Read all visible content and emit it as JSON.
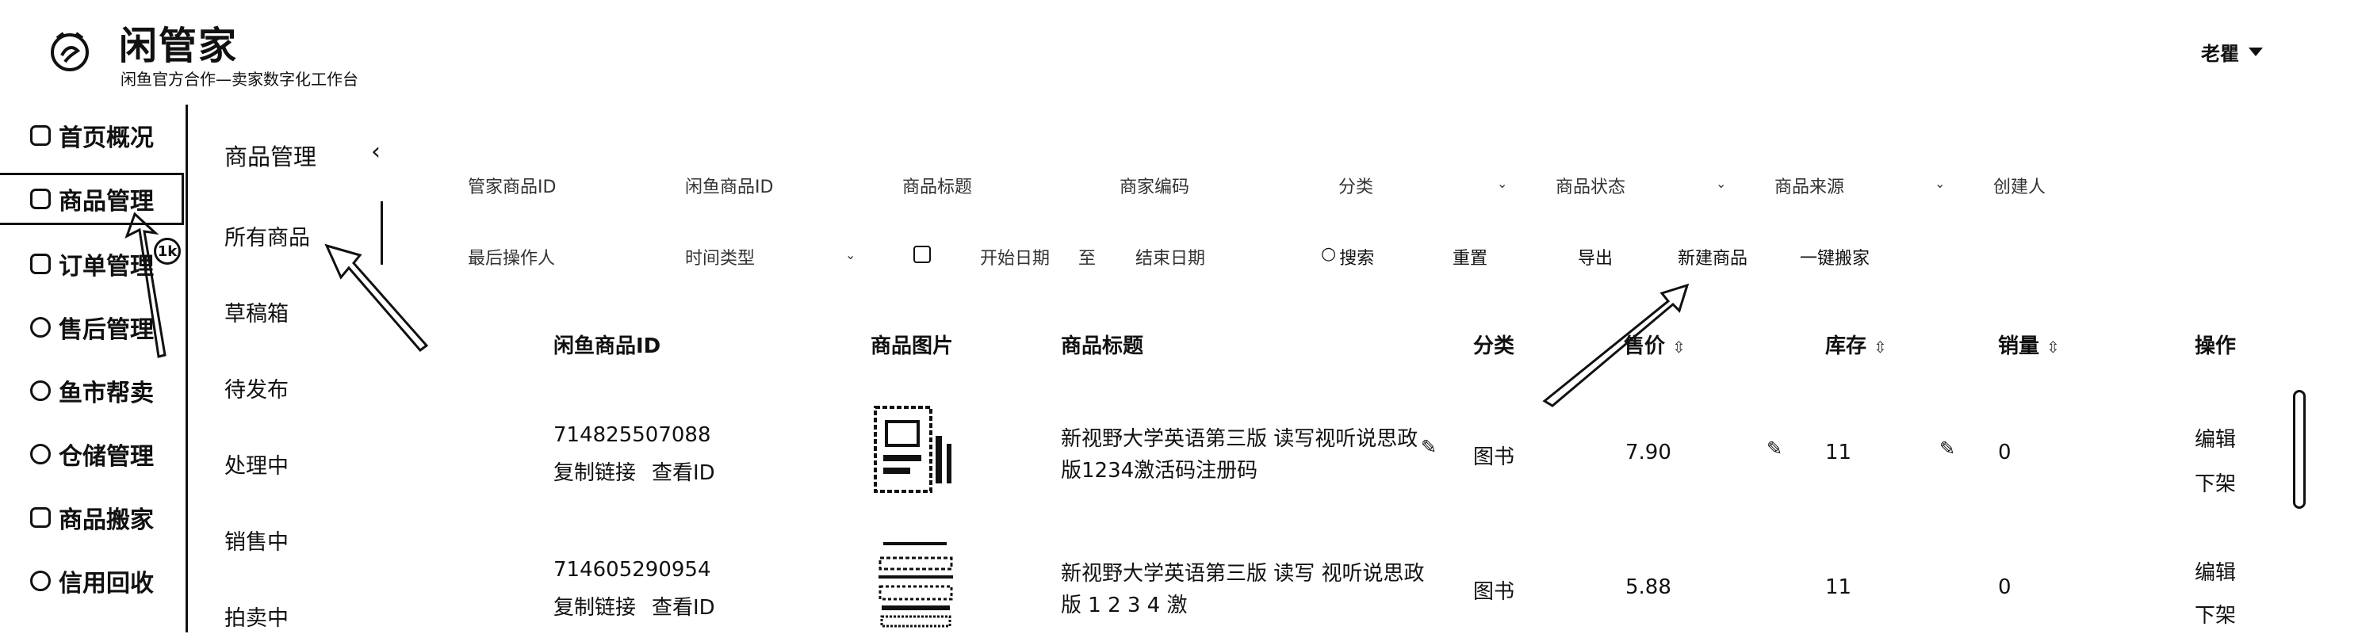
{
  "header": {
    "app_name": "闲管家",
    "subtitle": "闲鱼官方合作—卖家数字化工作台",
    "user": "老瞿"
  },
  "sidebar": {
    "items": [
      {
        "label": "首页概况",
        "icon": "dashboard-icon"
      },
      {
        "label": "商品管理",
        "icon": "product-icon"
      },
      {
        "label": "订单管理",
        "icon": "order-icon"
      },
      {
        "label": "售后管理",
        "icon": "after-sales-icon"
      },
      {
        "label": "鱼市帮卖",
        "icon": "market-icon"
      },
      {
        "label": "仓储管理",
        "icon": "warehouse-icon"
      },
      {
        "label": "商品搬家",
        "icon": "move-icon"
      },
      {
        "label": "信用回收",
        "icon": "recycle-icon"
      }
    ],
    "order_badge": "1k"
  },
  "subnav": {
    "title": "商品管理",
    "items": [
      "所有商品",
      "草稿箱",
      "待发布",
      "处理中",
      "销售中",
      "拍卖中"
    ]
  },
  "filters": {
    "row1": [
      "管家商品ID",
      "闲鱼商品ID",
      "商品标题",
      "商家编码",
      "分类",
      "商品状态",
      "商品来源",
      "创建人"
    ],
    "row2": {
      "last_operator": "最后操作人",
      "time_type": "时间类型",
      "start_date": "开始日期",
      "to": "至",
      "end_date": "结束日期",
      "search": "搜索",
      "reset": "重置",
      "export": "导出",
      "new_product": "新建商品",
      "one_click_move": "一键搬家"
    }
  },
  "table": {
    "headers": [
      "闲鱼商品ID",
      "商品图片",
      "商品标题",
      "分类",
      "售价",
      "库存",
      "销量",
      "操作"
    ],
    "rows": [
      {
        "id": "714825507088",
        "copy_link": "复制链接",
        "view_id": "查看ID",
        "title": "新视野大学英语第三版 读写视听说思政版1234激活码注册码",
        "category": "图书",
        "price": "7.90",
        "stock": "11",
        "sales": "0",
        "edit": "编辑",
        "delist": "下架"
      },
      {
        "id": "714605290954",
        "copy_link": "复制链接",
        "view_id": "查看ID",
        "title": "新视野大学英语第三版 读写 视听说思政版 1 2 3 4 激",
        "category": "图书",
        "price": "5.88",
        "stock": "11",
        "sales": "0",
        "edit": "编辑",
        "delist": "下架"
      }
    ]
  }
}
